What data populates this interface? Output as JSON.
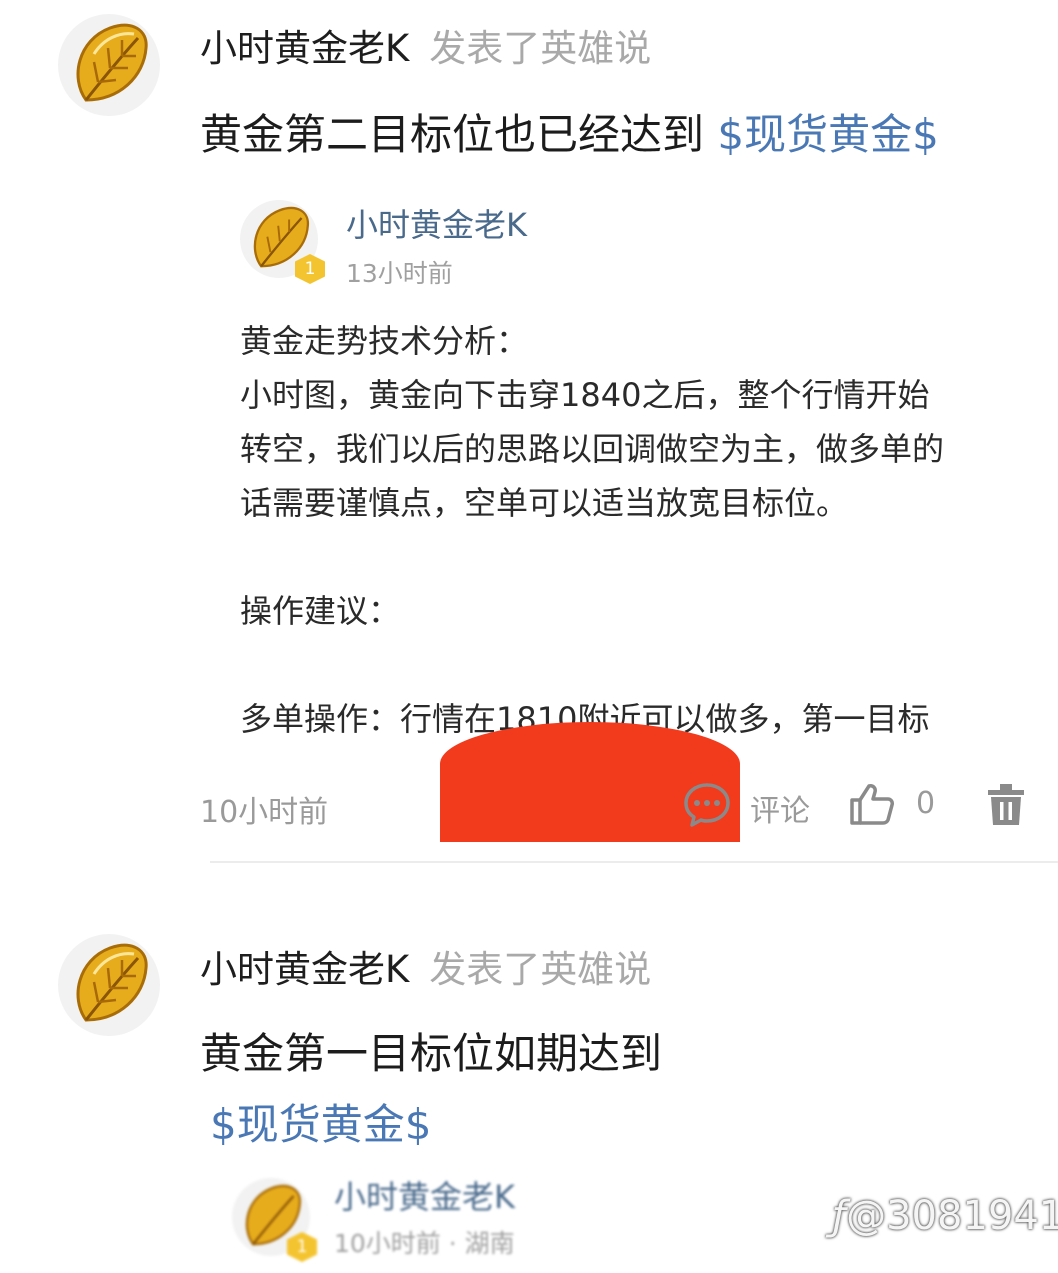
{
  "posts": [
    {
      "author": "小时黄金老K",
      "action": "发表了英雄说",
      "text": "黄金第二目标位也已经达到",
      "tag": "$现货黄金$",
      "quote": {
        "author": "小时黄金老K",
        "badge": "1",
        "time": "13小时前",
        "lines": [
          "黄金走势技术分析：",
          "小时图，黄金向下击穿1840之后，整个行情开始",
          "转空，我们以后的思路以回调做空为主，做多单的",
          "话需要谨慎点，空单可以适当放宽目标位。",
          "",
          "操作建议：",
          "",
          "多单操作：行情在1810附近可以做多，第一目标"
        ]
      },
      "time": "10小时前",
      "comment_label": "评论",
      "like_count": "0"
    },
    {
      "author": "小时黄金老K",
      "action": "发表了英雄说",
      "text": "黄金第一目标位如期达到",
      "tag": "$现货黄金$",
      "quote": {
        "author": "小时黄金老K",
        "badge": "1",
        "time": "10小时前 · 湖南"
      }
    }
  ],
  "watermark": "@3081941",
  "icons": {
    "avatar": "gold-leaf-icon",
    "comment": "comment-bubble-icon",
    "like": "thumbs-up-icon",
    "delete": "trash-icon"
  },
  "colors": {
    "tag": "#4a78b5",
    "quote_author": "#4a6a8c",
    "muted": "#a9a9a9",
    "redaction": "#f23a1d",
    "badge": "#f4c430"
  }
}
